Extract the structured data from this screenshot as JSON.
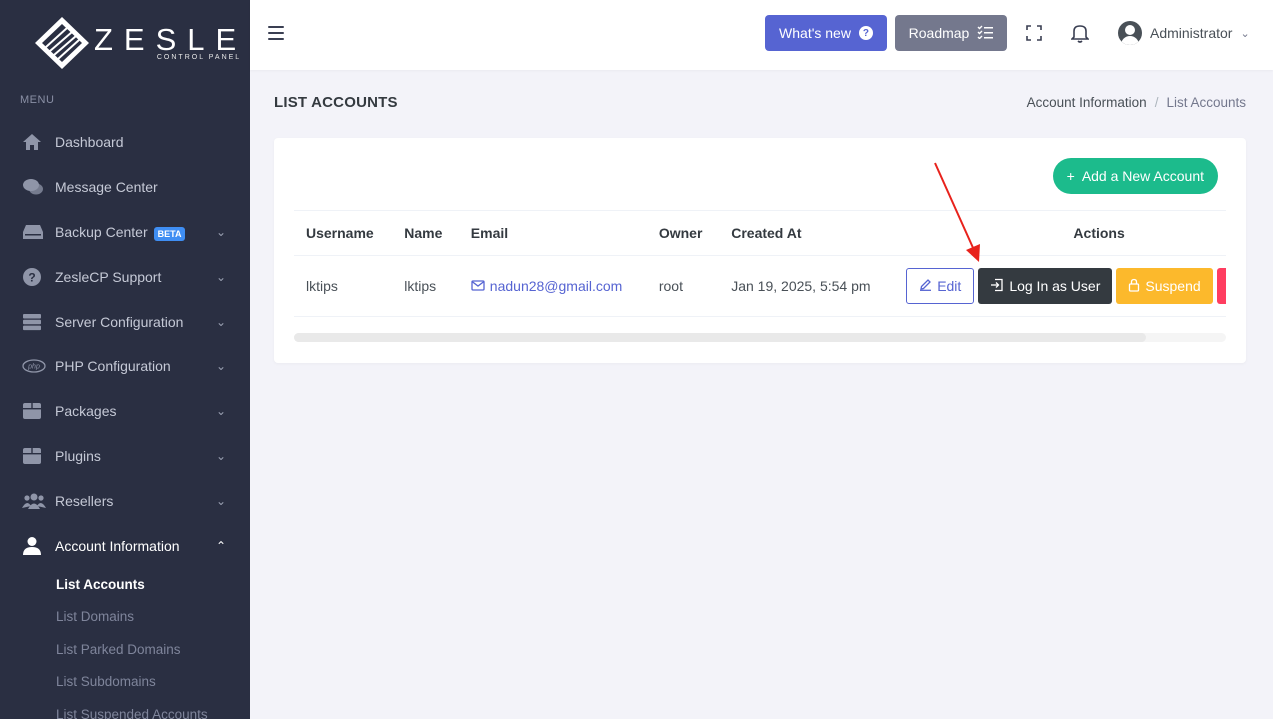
{
  "sidebar": {
    "logo_title": "ZESLE",
    "logo_subtitle": "CONTROL PANEL",
    "menu_label": "MENU",
    "items": [
      {
        "label": "Dashboard",
        "icon": "home-icon"
      },
      {
        "label": "Message Center",
        "icon": "chat-icon"
      },
      {
        "label": "Backup Center",
        "icon": "drive-icon",
        "badge": "BETA"
      },
      {
        "label": "ZesleCP Support",
        "icon": "help-icon"
      },
      {
        "label": "Server Configuration",
        "icon": "server-icon"
      },
      {
        "label": "PHP Configuration",
        "icon": "php-icon",
        "icon_text": "php"
      },
      {
        "label": "Packages",
        "icon": "package-icon"
      },
      {
        "label": "Plugins",
        "icon": "plugin-icon"
      },
      {
        "label": "Resellers",
        "icon": "users-icon"
      },
      {
        "label": "Account Information",
        "icon": "user-icon"
      }
    ],
    "subitems": [
      {
        "label": "List Accounts"
      },
      {
        "label": "List Domains"
      },
      {
        "label": "List Parked Domains"
      },
      {
        "label": "List Subdomains"
      },
      {
        "label": "List Suspended Accounts"
      }
    ]
  },
  "topbar": {
    "whats_new": "What's new",
    "whats_new_icon": "?",
    "roadmap": "Roadmap",
    "user_name": "Administrator"
  },
  "page": {
    "title": "LIST ACCOUNTS",
    "breadcrumb_parent": "Account Information",
    "breadcrumb_separator": "/",
    "breadcrumb_current": "List Accounts"
  },
  "card": {
    "add_button": "Add a New Account",
    "add_icon": "+",
    "columns": [
      "Username",
      "Name",
      "Email",
      "Owner",
      "Created At",
      "Actions"
    ],
    "rows": [
      {
        "username": "lktips",
        "name": "lktips",
        "email": "nadun28@gmail.com",
        "owner": "root",
        "created_at": "Jan 19, 2025, 5:54 pm"
      }
    ],
    "actions": {
      "edit": "Edit",
      "login": "Log In as User",
      "suspend": "Suspend",
      "delete_visible": "T"
    }
  },
  "colors": {
    "sidebar_bg": "#2a2f42",
    "primary": "#5664d2",
    "success": "#1cbb8c",
    "warning": "#fcb92c",
    "danger": "#ff3d60",
    "dark": "#343a40",
    "annotation_arrow": "#e8221c"
  }
}
